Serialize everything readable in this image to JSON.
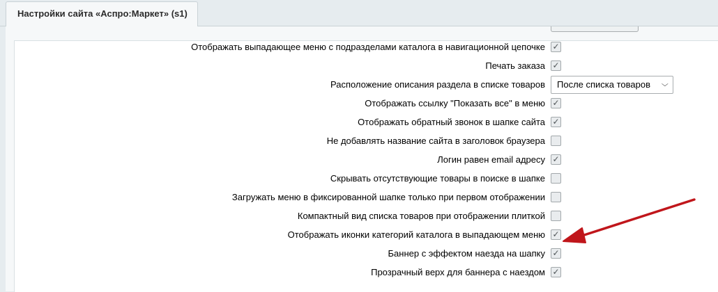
{
  "header": {
    "tab_title": "Настройки сайта «Аспро:Маркет» (s1)"
  },
  "settings": [
    {
      "label": "Отображать выпадающее меню с подразделами каталога в навигационной цепочке",
      "type": "checkbox",
      "checked": true
    },
    {
      "label": "Печать заказа",
      "type": "checkbox",
      "checked": true
    },
    {
      "label": "Расположение описания раздела в списке товаров",
      "type": "select",
      "value": "После списка товаров"
    },
    {
      "label": "Отображать ссылку \"Показать все\" в меню",
      "type": "checkbox",
      "checked": true
    },
    {
      "label": "Отображать обратный звонок в шапке сайта",
      "type": "checkbox",
      "checked": true
    },
    {
      "label": "Не добавлять название сайта в заголовок браузера",
      "type": "checkbox",
      "checked": false
    },
    {
      "label": "Логин равен email адресу",
      "type": "checkbox",
      "checked": true
    },
    {
      "label": "Скрывать отсутствующие товары в поиске в шапке",
      "type": "checkbox",
      "checked": false
    },
    {
      "label": "Загружать меню в фиксированной шапке только при первом отображении",
      "type": "checkbox",
      "checked": false
    },
    {
      "label": "Компактный вид списка товаров при отображении плиткой",
      "type": "checkbox",
      "checked": false
    },
    {
      "label": "Отображать иконки категорий каталога в выпадающем меню",
      "type": "checkbox",
      "checked": true
    },
    {
      "label": "Баннер с эффектом наезда на шапку",
      "type": "checkbox",
      "checked": true
    },
    {
      "label": "Прозрачный верх для баннера с наездом",
      "type": "checkbox",
      "checked": true
    }
  ],
  "icons": {
    "check": "checkmark-icon",
    "select": "chevron-down-icon",
    "annotation": "red-arrow-annotation"
  },
  "colors": {
    "arrow": "#c0161b"
  }
}
